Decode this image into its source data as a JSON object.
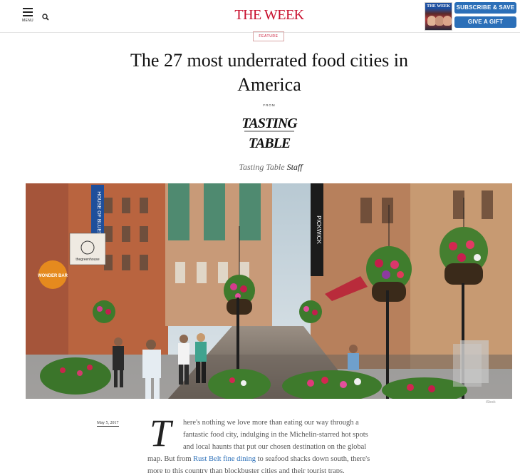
{
  "header": {
    "menu_label": "MENU",
    "logo_text": "THE WEEK",
    "magazine_cover_title": "THE WEEK",
    "subscribe_label": "SUBSCRIBE & SAVE",
    "gift_label": "GIVE A GIFT",
    "brand_color": "#c8102e",
    "button_color": "#2b6fb8"
  },
  "article": {
    "section_tag": "FEATURE",
    "headline": "The 27 most underrated food cities in America",
    "from_label": "FROM",
    "source_name": "Tasting Table",
    "byline_source": "Tasting Table",
    "byline_author": "Staff",
    "photo_credit": "iStock",
    "hero_sign_left": "HOUSE OF BLUES",
    "hero_sign_center": "PICKWICK",
    "hero_sign_wonder": "WONDER BAR",
    "hero_sign_greenhouse": "thegreenhouse",
    "date": "May 5, 2017",
    "dropcap": "T",
    "body_lines": {
      "l1": "here's nothing we love more than eating our way through a",
      "l2": "fantastic food city, indulging in the Michelin-starred hot spots",
      "l3": "and local haunts that put our chosen destination on the global",
      "l4_pre": "map. But from ",
      "l4_link": "Rust Belt fine dining",
      "l4_post": " to seafood shacks down south, there's",
      "l5": "more to this country than blockbuster cities and their tourist traps."
    }
  },
  "icons": [
    "hamburger-menu-icon",
    "search-icon"
  ]
}
